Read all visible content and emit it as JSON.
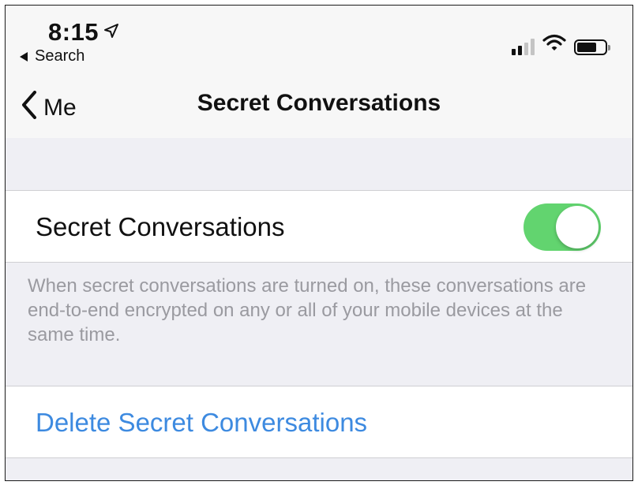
{
  "status_bar": {
    "time": "8:15",
    "back_app_label": "Search",
    "signal_bars_filled": 2,
    "battery_level": 0.72,
    "icons": [
      "location-arrow-icon",
      "signal-bars-icon",
      "wifi-icon",
      "battery-icon"
    ]
  },
  "nav": {
    "back_label": "Me",
    "title": "Secret Conversations"
  },
  "settings": {
    "toggle_label": "Secret Conversations",
    "toggle_on": true,
    "footer": "When secret conversations are turned on, these conversations are end-to-end encrypted on any or all of your mobile devices at the same time.",
    "delete_label": "Delete Secret Conversations"
  },
  "colors": {
    "toggle_on": "#62d46f",
    "link": "#3d8ae0",
    "footer_text": "#9a9aa0",
    "background": "#efeff4"
  }
}
